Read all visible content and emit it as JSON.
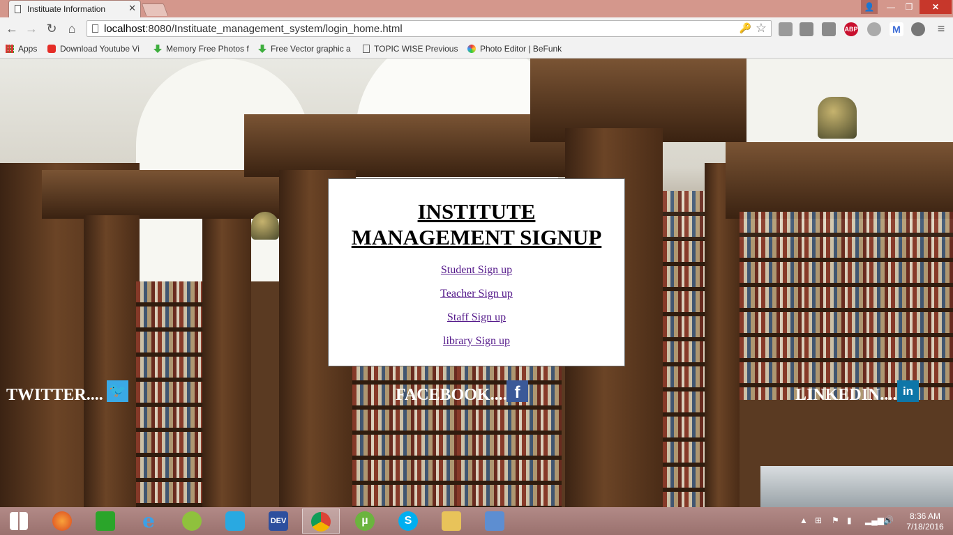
{
  "browser": {
    "tab_title": "Instituate Information",
    "url_host": "localhost",
    "url_path": ":8080/Instituate_management_system/login_home.html",
    "extensions": [
      "ABP"
    ]
  },
  "bookmarks": [
    {
      "label": "Apps"
    },
    {
      "label": "Download Youtube Vi"
    },
    {
      "label": "Memory Free Photos f"
    },
    {
      "label": "Free Vector graphic a"
    },
    {
      "label": "TOPIC WISE Previous"
    },
    {
      "label": "Photo Editor | BeFunk"
    }
  ],
  "signup": {
    "title_line1": "INSTITUTE",
    "title_line2": "MANAGEMENT SIGNUP",
    "links": [
      "Student Sign up",
      "Teacher Sign up",
      "Staff Sign up",
      "library Sign up"
    ]
  },
  "social": {
    "twitter": "TWITTER....",
    "facebook": "FACEBOOK....",
    "linkedin": "LINKEDIN...."
  },
  "taskbar": {
    "apps": [
      "windows-start",
      "firefox",
      "store",
      "internet-explorer",
      "android-studio",
      "share",
      "dev-cpp",
      "chrome",
      "utorrent",
      "skype",
      "file-explorer",
      "virtualbox"
    ],
    "dev_label": "DEV",
    "time": "8:36 AM",
    "date": "7/18/2016"
  },
  "colors": {
    "titlebar": "#d4978c",
    "link": "#551a8b",
    "twitter": "#3aa9e6",
    "facebook": "#3b5998",
    "linkedin": "#0e76a8"
  }
}
